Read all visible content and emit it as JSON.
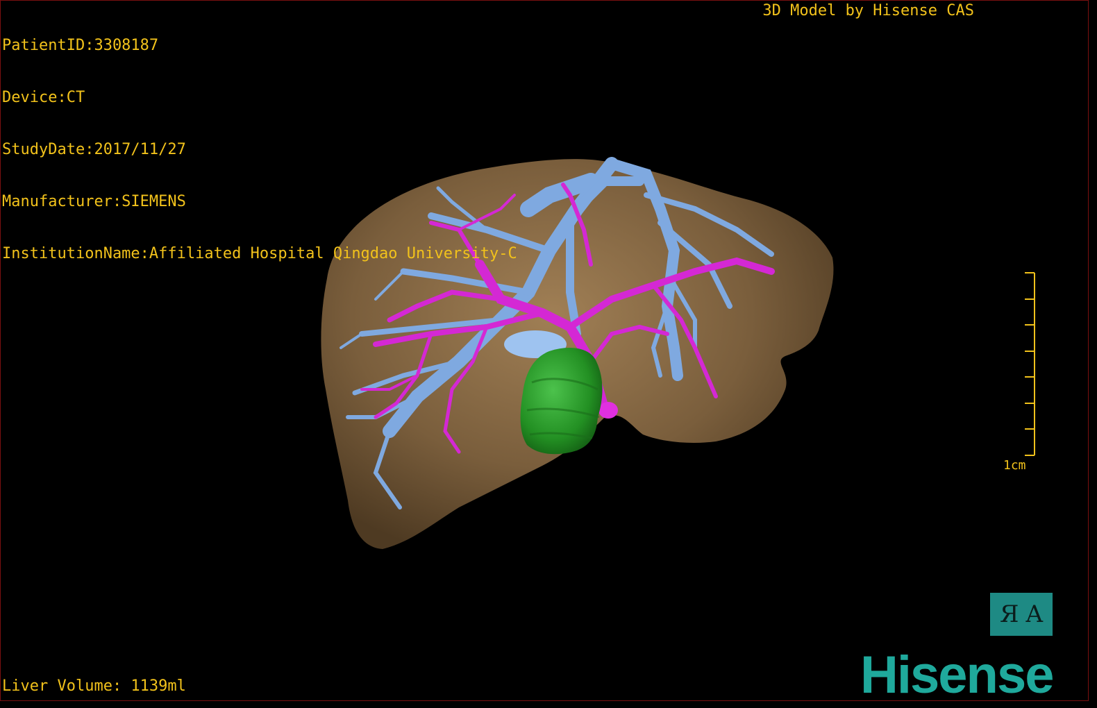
{
  "header": {
    "patient_id": "PatientID:3308187",
    "device": "Device:CT",
    "study_date": "StudyDate:2017/11/27",
    "manufacturer": "Manufacturer:SIEMENS",
    "institution": "InstitutionName:Affiliated Hospital Qingdao University-C"
  },
  "top_right": {
    "model_by": "3D Model by Hisense CAS"
  },
  "footer": {
    "liver_volume": "Liver Volume: 1139ml"
  },
  "scale_bar": {
    "label": "1cm",
    "tick_count": 8
  },
  "orientation_cube": {
    "face_left": "Я",
    "face_right": "A"
  },
  "brand": {
    "logo_text": "Hisense"
  },
  "colors": {
    "text": "#f2c21b",
    "liver": "#7a5e3c",
    "portal_vein": "#7fa9e0",
    "hepatic_artery": "#d428d4",
    "tumor": "#2f9e2f",
    "brand": "#1fa99c"
  },
  "structures": [
    "liver",
    "portal-vein",
    "hepatic-artery",
    "tumor"
  ]
}
